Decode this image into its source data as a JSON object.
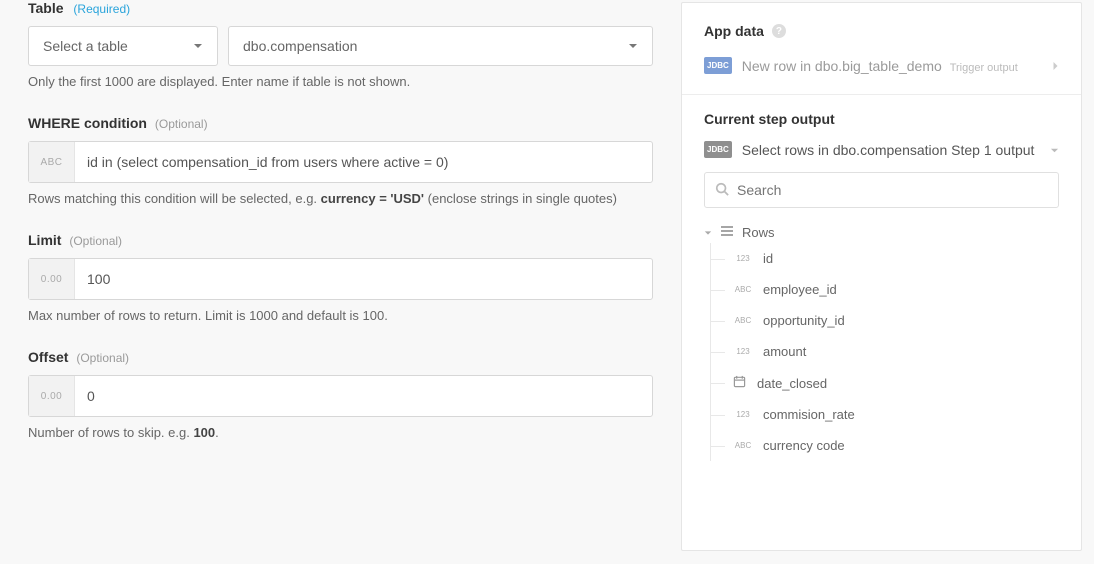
{
  "left": {
    "table": {
      "label": "Table",
      "required_text": "(Required)",
      "select1": "Select a table",
      "select2": "dbo.compensation",
      "help": "Only the first 1000 are displayed. Enter name if table is not shown."
    },
    "where": {
      "label": "WHERE condition",
      "optional_text": "(Optional)",
      "prefix": "ABC",
      "value": "id in (select compensation_id from users where active = 0)",
      "help_pre": "Rows matching this condition will be selected, e.g. ",
      "help_bold": "currency = 'USD'",
      "help_post": " (enclose strings in single quotes)"
    },
    "limit": {
      "label": "Limit",
      "optional_text": "(Optional)",
      "prefix": "0.00",
      "value": "100",
      "help": "Max number of rows to return. Limit is 1000 and default is 100."
    },
    "offset": {
      "label": "Offset",
      "optional_text": "(Optional)",
      "prefix": "0.00",
      "value": "0",
      "help_pre": "Number of rows to skip. e.g. ",
      "help_bold": "100",
      "help_post": "."
    }
  },
  "right": {
    "app_data_label": "App data",
    "trigger": {
      "badge": "JDBC",
      "text": "New row in dbo.big_table_demo",
      "sub": "Trigger output"
    },
    "current_step_label": "Current step output",
    "step": {
      "badge": "JDBC",
      "text": "Select rows in dbo.compensation",
      "sub": "Step 1 output"
    },
    "search_placeholder": "Search",
    "rows_label": "Rows",
    "fields": [
      {
        "type": "123",
        "name": "id"
      },
      {
        "type": "ABC",
        "name": "employee_id"
      },
      {
        "type": "ABC",
        "name": "opportunity_id"
      },
      {
        "type": "123",
        "name": "amount"
      },
      {
        "type": "date",
        "name": "date_closed"
      },
      {
        "type": "123",
        "name": "commision_rate"
      },
      {
        "type": "ABC",
        "name": "currency code"
      }
    ]
  }
}
